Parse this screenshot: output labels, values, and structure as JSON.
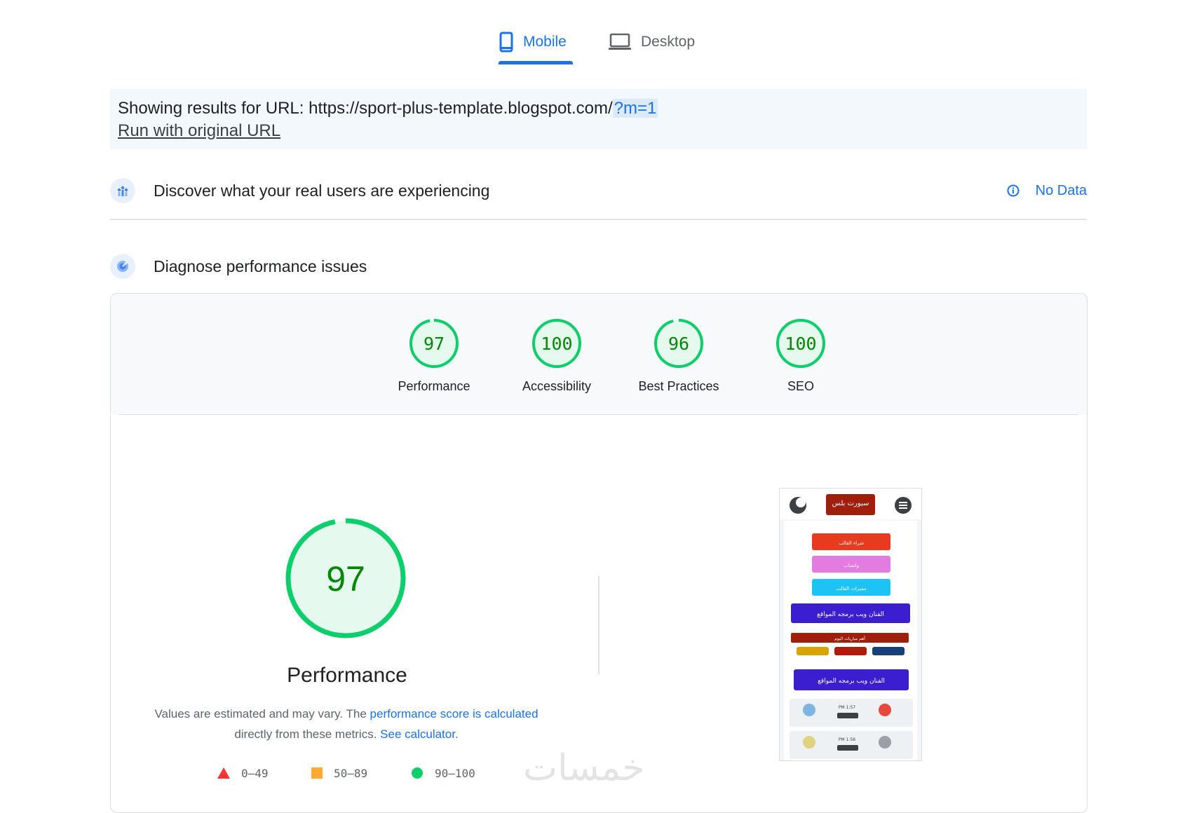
{
  "tabs": [
    {
      "label": "Mobile",
      "icon": "smartphone-icon",
      "active": true
    },
    {
      "label": "Desktop",
      "icon": "laptop-icon",
      "active": false
    }
  ],
  "url_banner": {
    "prefix": "Showing results for URL: https://sport-plus-template.blogspot.com/",
    "param": "?m=1",
    "run_original": "Run with original URL"
  },
  "field_data": {
    "title": "Discover what your real users are experiencing",
    "status": "No Data",
    "icon": "users-chart-icon",
    "status_icon": "info-icon"
  },
  "diagnose": {
    "title": "Diagnose performance issues",
    "icon": "lighthouse-icon"
  },
  "scores": [
    {
      "label": "Performance",
      "value": "97",
      "fraction": 0.97
    },
    {
      "label": "Accessibility",
      "value": "100",
      "fraction": 1.0
    },
    {
      "label": "Best Practices",
      "value": "96",
      "fraction": 0.96
    },
    {
      "label": "SEO",
      "value": "100",
      "fraction": 1.0
    }
  ],
  "performance": {
    "score": "97",
    "fraction": 0.97,
    "title": "Performance",
    "desc_part1": "Values are estimated and may vary. The ",
    "desc_link1": "performance score is calculated",
    "desc_part2": " directly from these metrics. ",
    "desc_link2": "See calculator."
  },
  "legend": [
    {
      "range": "0–49",
      "shape": "triangle",
      "color": "#ff3333"
    },
    {
      "range": "50–89",
      "shape": "square",
      "color": "#ffaa33"
    },
    {
      "range": "90–100",
      "shape": "circle",
      "color": "#0cce6b"
    }
  ],
  "colors": {
    "accent": "#1a73e8",
    "pass": "#0cce6b",
    "pass_text": "#008800",
    "pass_bg": "#e6f9ee"
  },
  "thumbnail": {
    "site_title": "سبورت بلس",
    "buttons": [
      "شراء القالب",
      "واتساب",
      "مميزات القالب",
      "الفنان ويب برمجه المواقع",
      "أهم مباريات اليوم",
      "الفنان ويب برمجه المواقع"
    ],
    "match_time_1": "PM 1:57",
    "match_time_2": "PM 1:56"
  },
  "watermark": "خمسات"
}
